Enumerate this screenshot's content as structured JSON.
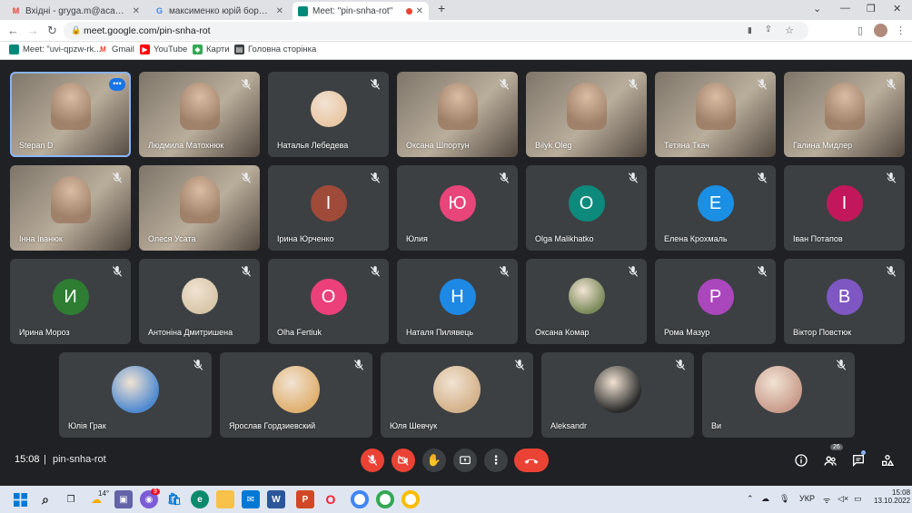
{
  "browser": {
    "tabs": [
      {
        "label": "Вхідні - gryga.m@academia.vn.ua",
        "favicon": "gmail-icon"
      },
      {
        "label": "максименко юрій борисович -",
        "favicon": "google-icon"
      },
      {
        "label": "Meet: \"pin-snha-rot\"",
        "favicon": "meet-icon"
      }
    ],
    "new_tab": "+",
    "url": "meet.google.com/pin-snha-rot",
    "bookmarks": [
      {
        "label": "Meet: \"uvi-qpzw-rk...",
        "icon": "meet-icon"
      },
      {
        "label": "Gmail",
        "icon": "gmail-icon"
      },
      {
        "label": "YouTube",
        "icon": "youtube-icon"
      },
      {
        "label": "Карти",
        "icon": "maps-icon"
      },
      {
        "label": "Головна сторінка",
        "icon": "home-page-icon"
      }
    ]
  },
  "colors": {
    "tile_bg": "#3c4043",
    "page_bg": "#202124",
    "leave_red": "#ea4335",
    "highlight": "#8ab4f8"
  },
  "meeting": {
    "row1": [
      {
        "name": "Stepan D",
        "kind": "video",
        "highlight": true
      },
      {
        "name": "Людмила Матохнюк",
        "kind": "video"
      },
      {
        "name": "Наталья Лебедева",
        "kind": "photo",
        "color": "#e9c7a4"
      },
      {
        "name": "Оксана Шпортун",
        "kind": "video"
      },
      {
        "name": "Bilyk Oleg",
        "kind": "video"
      },
      {
        "name": "Тетяна Ткач",
        "kind": "video"
      },
      {
        "name": "Галина Мидлер",
        "kind": "video"
      }
    ],
    "row2": [
      {
        "name": "Інна Іванюк",
        "kind": "video"
      },
      {
        "name": "Олеся Усата",
        "kind": "video"
      },
      {
        "name": "Ірина Юрченко",
        "kind": "avatar",
        "letter": "І",
        "color": "#a04a3a"
      },
      {
        "name": "Юлия",
        "kind": "avatar",
        "letter": "Ю",
        "color": "#e8457a"
      },
      {
        "name": "Olga Malikhatko",
        "kind": "avatar",
        "letter": "O",
        "color": "#0d8a7c"
      },
      {
        "name": "Елена Крохмаль",
        "kind": "avatar",
        "letter": "Е",
        "color": "#1a8fe3"
      },
      {
        "name": "Іван Потапов",
        "kind": "avatar",
        "letter": "І",
        "color": "#c2185b"
      }
    ],
    "row3": [
      {
        "name": "Ирина Мороз",
        "kind": "avatar",
        "letter": "И",
        "color": "#2e7d32"
      },
      {
        "name": "Антоніна Дмитришена",
        "kind": "photo",
        "color": "#d8c6a8"
      },
      {
        "name": "Olha Fertiuk",
        "kind": "avatar",
        "letter": "O",
        "color": "#ec407a"
      },
      {
        "name": "Наталя Пилявець",
        "kind": "avatar",
        "letter": "Н",
        "color": "#1e88e5"
      },
      {
        "name": "Оксана Комар",
        "kind": "photo",
        "color": "#7a8a5a"
      },
      {
        "name": "Рома Мазур",
        "kind": "avatar",
        "letter": "Р",
        "color": "#ab47bc"
      },
      {
        "name": "Віктор Повстюк",
        "kind": "avatar",
        "letter": "В",
        "color": "#7e57c2"
      }
    ],
    "row4": [
      {
        "name": "Юлія Грак",
        "kind": "photo",
        "color": "#4f8ad0"
      },
      {
        "name": "Ярослав Гордзиевский",
        "kind": "photo",
        "color": "#e0b070"
      },
      {
        "name": "Юля Шевчук",
        "kind": "photo",
        "color": "#d4b28a"
      },
      {
        "name": "Aleksandr",
        "kind": "photo",
        "color": "#2b2b2b"
      },
      {
        "name": "Ви",
        "kind": "photo",
        "color": "#c99c8c"
      }
    ],
    "clock": "15:08",
    "code": "pin-snha-rot",
    "participants_count": "26"
  },
  "taskbar": {
    "weather": "14°",
    "chat_badge": "9",
    "language": "УКР",
    "time": "15:08",
    "date": "13.10.2022"
  }
}
